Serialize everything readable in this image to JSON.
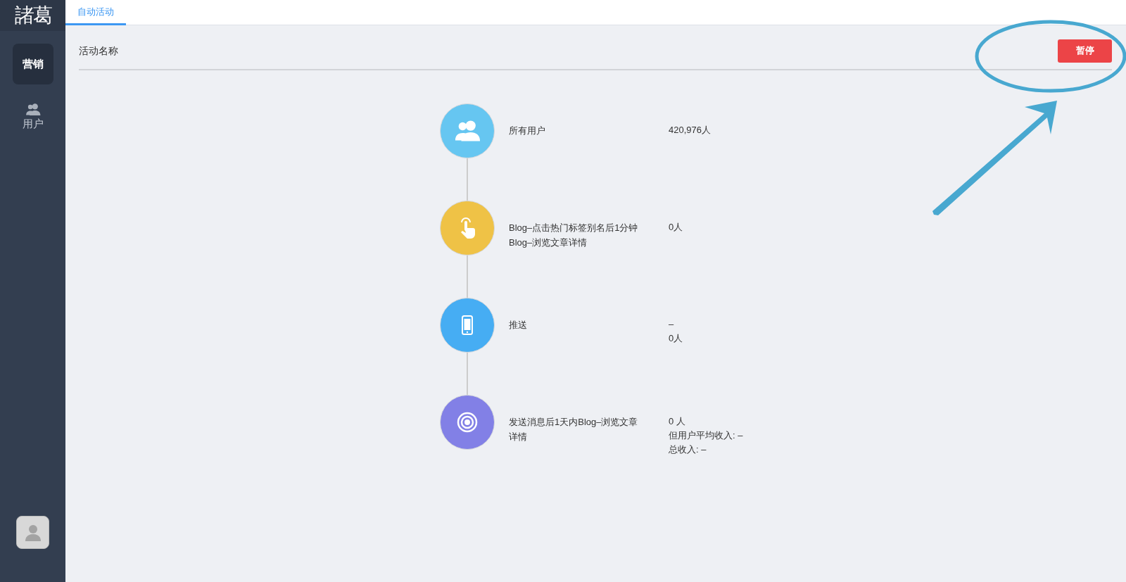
{
  "sidebar": {
    "logo": "諸葛",
    "items": [
      {
        "label": "营销",
        "kind": "text",
        "selected": true
      },
      {
        "label": "用户",
        "kind": "people",
        "selected": false
      }
    ]
  },
  "tabs": [
    {
      "label": "自动活动",
      "selected": true
    }
  ],
  "header": {
    "title": "活动名称",
    "button": "暂停"
  },
  "steps": [
    {
      "kind": "people",
      "color": "#66c6f1",
      "label": "所有用户",
      "values": [
        "420,976人"
      ]
    },
    {
      "kind": "tap",
      "color": "#efc246",
      "label": "Blog–点击热门标签别名后1分钟Blog–浏览文章详情",
      "values": [
        "0人"
      ]
    },
    {
      "kind": "phone",
      "color": "#46adf3",
      "label": "推送",
      "values": [
        "–",
        "0人"
      ]
    },
    {
      "kind": "target",
      "color": "#8280e6",
      "label": "发送消息后1天内Blog–浏览文章详情",
      "values": [
        "0 人",
        "但用户平均收入: –",
        "总收入: –"
      ]
    }
  ]
}
